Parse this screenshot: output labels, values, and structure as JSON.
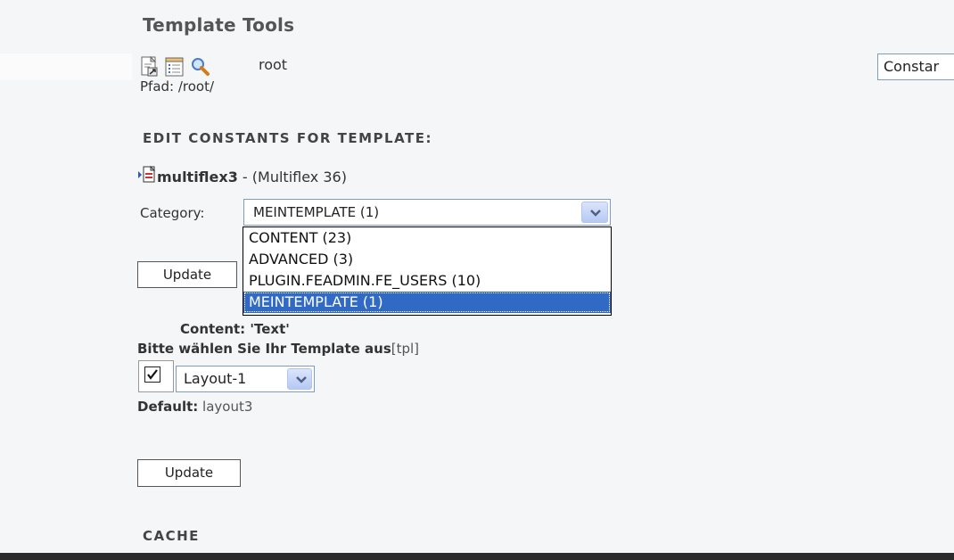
{
  "header": {
    "title": "Template Tools"
  },
  "toolbar": {
    "icons": [
      "new-page-icon",
      "list-view-icon",
      "search-icon"
    ],
    "root_label": "root",
    "path_text": "Pfad: /root/"
  },
  "top_right": {
    "selector_value": "Constar"
  },
  "edit_section": {
    "heading": "EDIT CONSTANTS FOR TEMPLATE:",
    "template_name": "multiflex3",
    "template_suffix": " - (Multiflex 36)"
  },
  "category": {
    "label": "Category:",
    "selected": "MEINTEMPLATE (1)",
    "options": [
      "CONTENT (23)",
      "ADVANCED (3)",
      "PLUGIN.FEADMIN.FE_USERS (10)",
      "MEINTEMPLATE (1)"
    ]
  },
  "buttons": {
    "update_label": "Update",
    "update_label_2": "Update"
  },
  "constant": {
    "section_title": "Content: 'Text'",
    "description_bold": "Bitte wählen Sie Ihr Template aus",
    "description_key": "[tpl]",
    "layout_value": "Layout-1",
    "default_label": "Default:",
    "default_value": " layout3"
  },
  "cache": {
    "heading": "CACHE"
  },
  "colors": {
    "selection": "#316ac5",
    "background": "#f5f6f7"
  }
}
